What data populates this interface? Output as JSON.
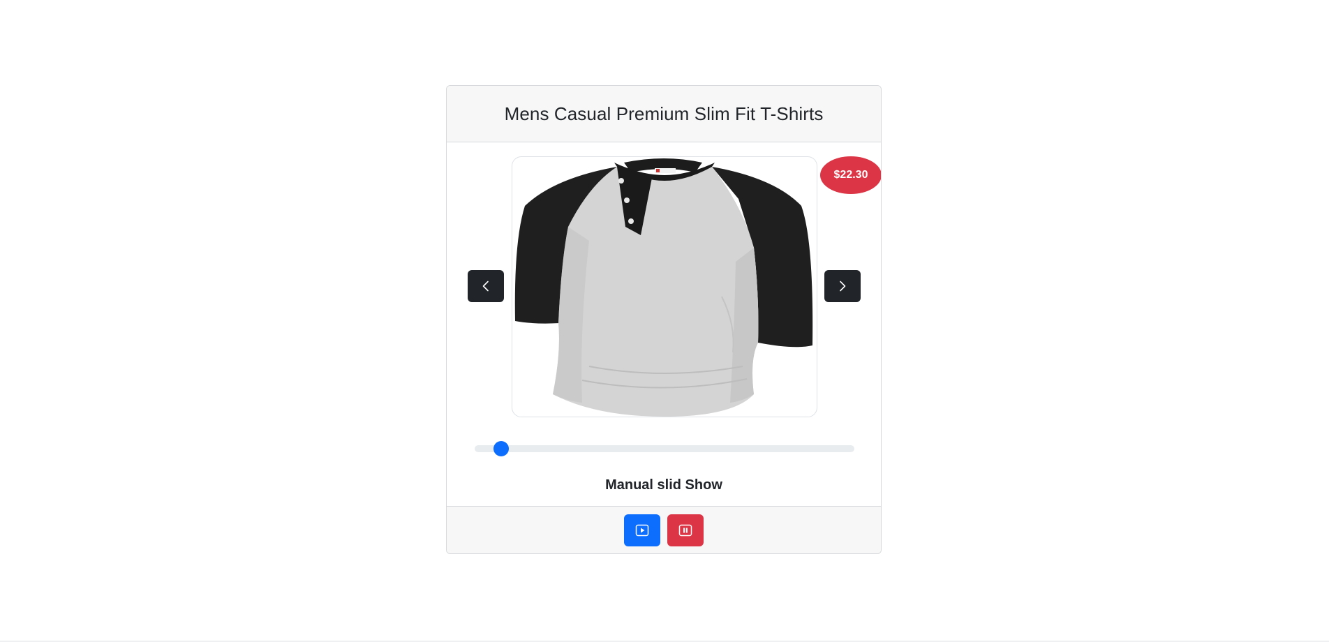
{
  "product": {
    "title": "Mens Casual Premium Slim Fit T-Shirts",
    "price": "$22.30",
    "image_alt": "Mens Casual Premium Slim Fit T-Shirts"
  },
  "slider": {
    "position_fraction": 0.07
  },
  "caption": "Manual slid Show",
  "controls": {
    "prev_icon": "chevron-left-icon",
    "next_icon": "chevron-right-icon",
    "play_icon": "play-icon",
    "pause_icon": "pause-icon"
  },
  "colors": {
    "primary": "#0d6efd",
    "danger": "#dc3545",
    "dark": "#212529"
  }
}
